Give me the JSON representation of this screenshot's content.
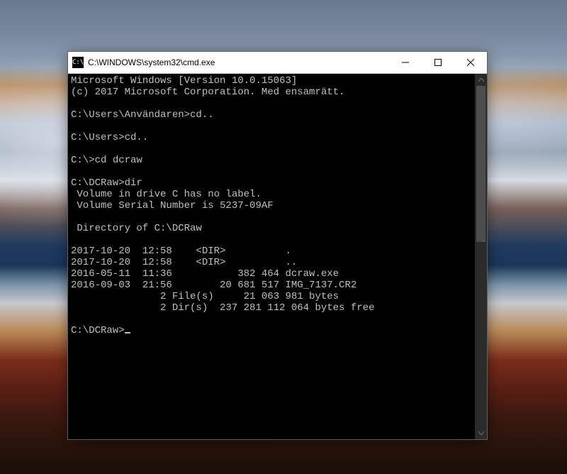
{
  "window": {
    "icon_label": "C:\\",
    "title": "C:\\WINDOWS\\system32\\cmd.exe"
  },
  "terminal": {
    "version_line": "Microsoft Windows [Version 10.0.15063]",
    "copyright_line": "(c) 2017 Microsoft Corporation. Med ensamrätt.",
    "prompts": [
      {
        "path": "C:\\Users\\Användaren>",
        "cmd": "cd.."
      },
      {
        "path": "C:\\Users>",
        "cmd": "cd.."
      },
      {
        "path": "C:\\>",
        "cmd": "cd dcraw"
      },
      {
        "path": "C:\\DCRaw>",
        "cmd": "dir"
      }
    ],
    "dir_output": {
      "volume_line": " Volume in drive C has no label.",
      "serial_line": " Volume Serial Number is 5237-09AF",
      "directory_of": " Directory of C:\\DCRaw",
      "entries": [
        "2017-10-20  12:58    <DIR>          .",
        "2017-10-20  12:58    <DIR>          ..",
        "2016-05-11  11:36           382 464 dcraw.exe",
        "2016-09-03  21:56        20 681 517 IMG_7137.CR2"
      ],
      "summary_files": "               2 File(s)     21 063 981 bytes",
      "summary_dirs": "               2 Dir(s)  237 281 112 064 bytes free"
    },
    "final_prompt": "C:\\DCRaw>"
  }
}
